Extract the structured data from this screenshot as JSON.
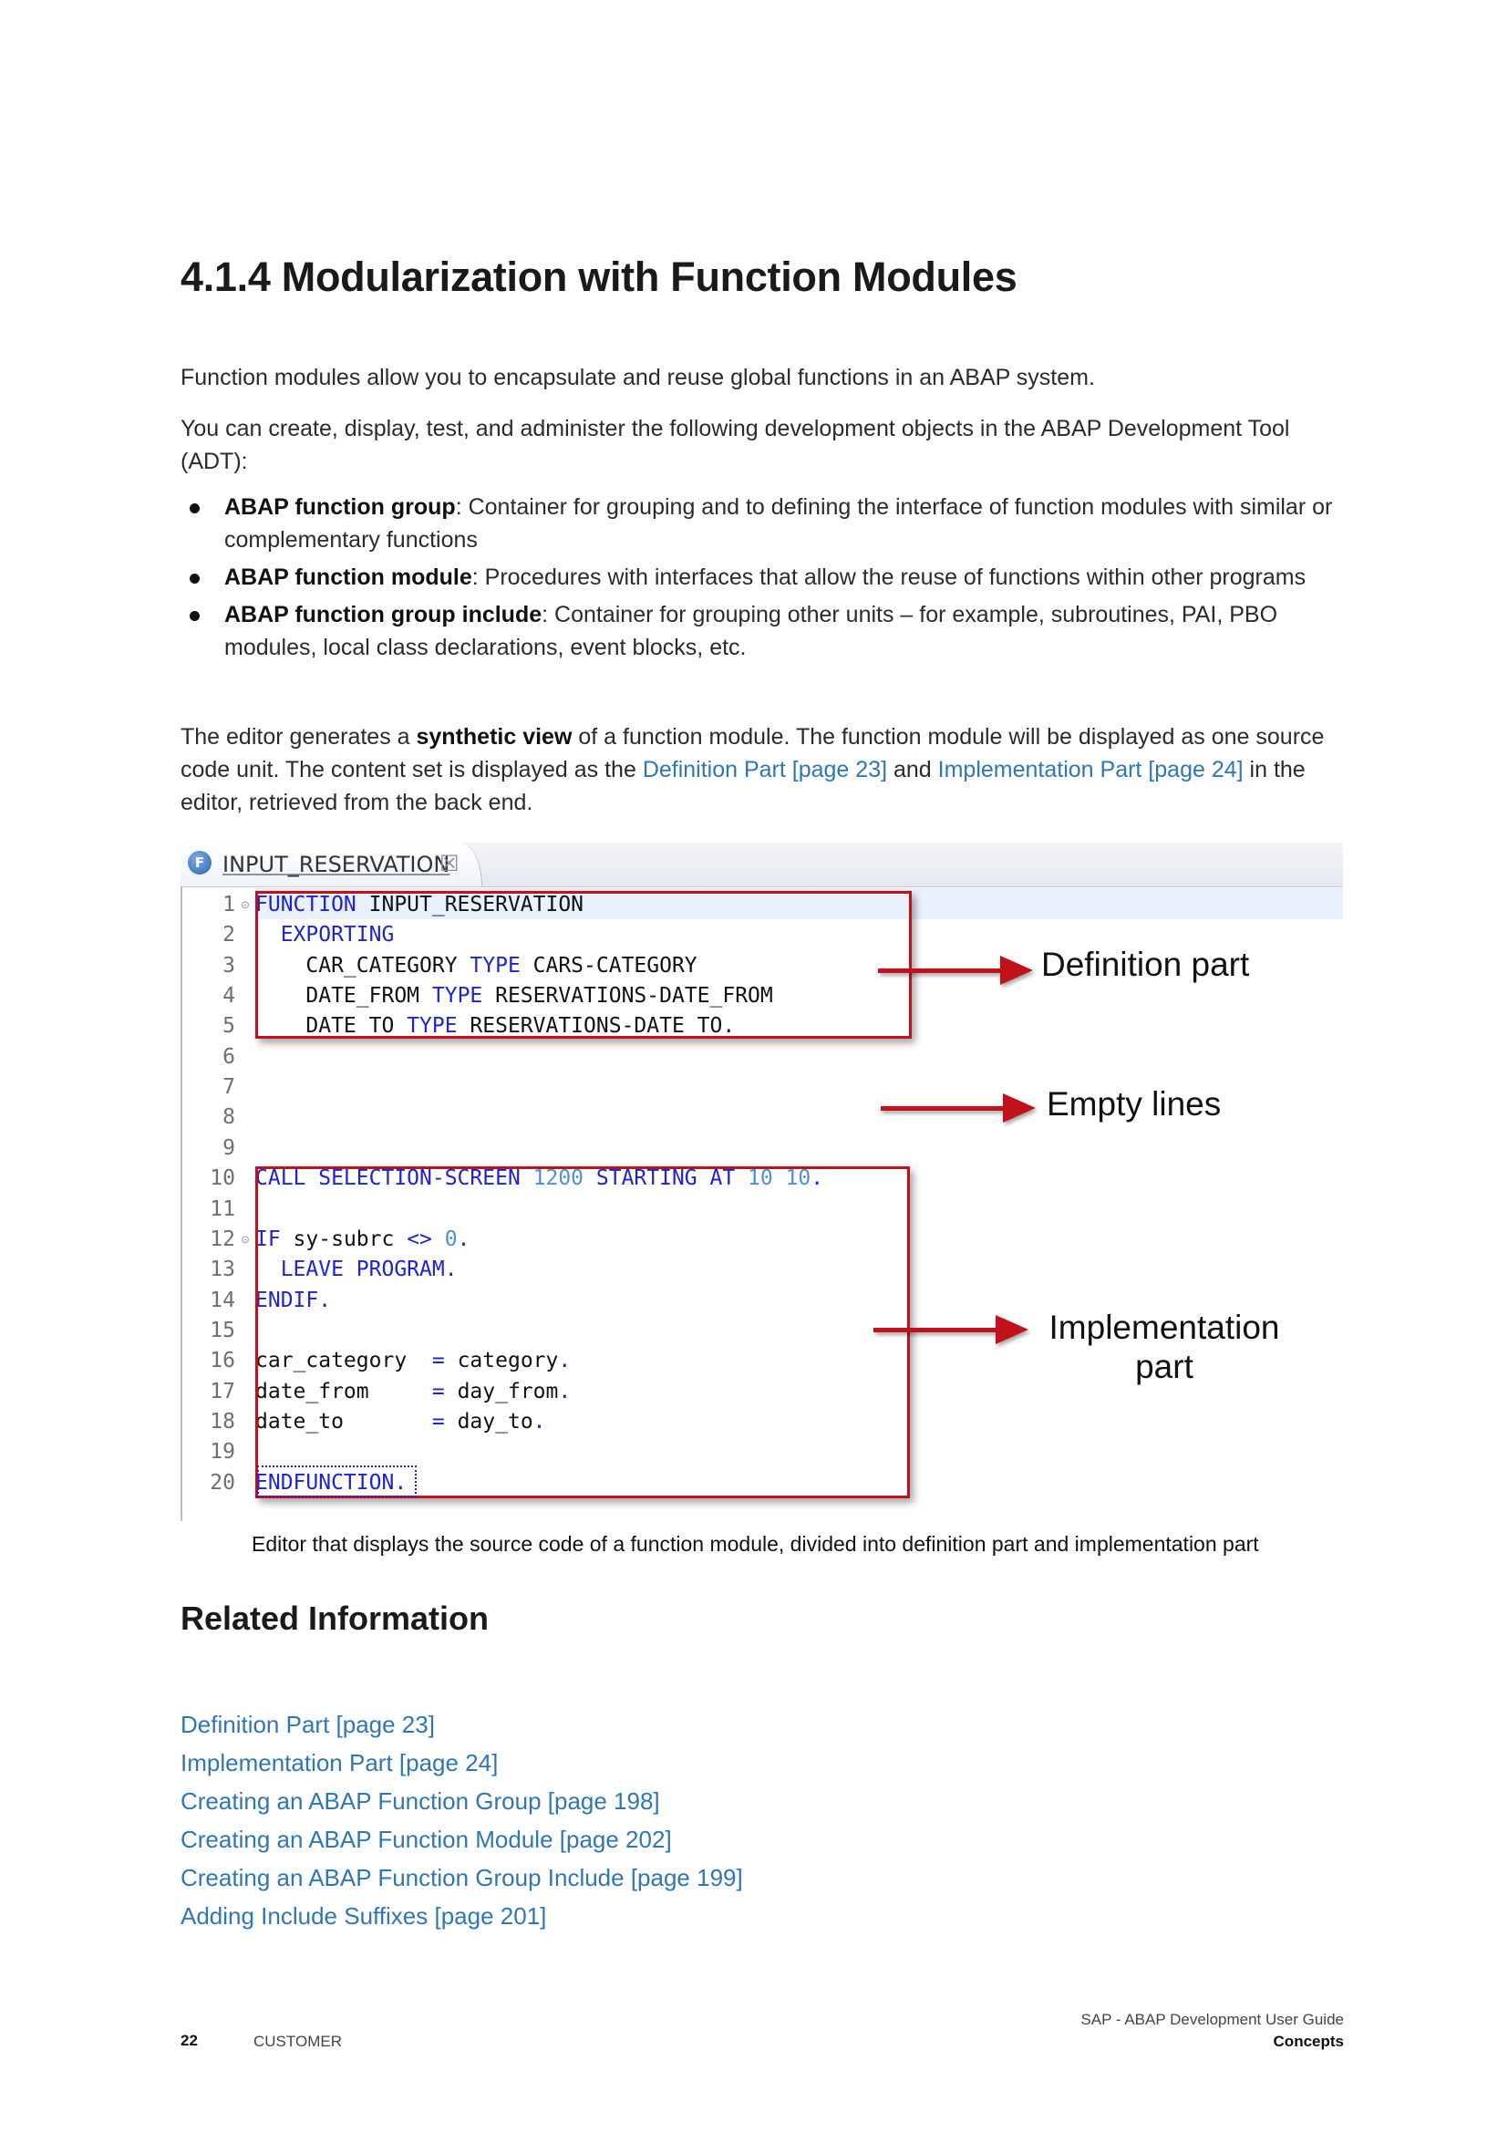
{
  "heading": "4.1.4  Modularization with Function Modules",
  "intro": {
    "p1": "Function modules allow you to encapsulate and reuse global functions in an ABAP system.",
    "p2": "You can create, display, test, and administer the following development objects in the ABAP Development Tool (ADT):"
  },
  "bullets": [
    {
      "term": "ABAP function group",
      "text": ": Container for grouping and to defining the interface of function modules with similar or complementary functions"
    },
    {
      "term": "ABAP function module",
      "text": ": Procedures with interfaces that allow the reuse of functions within other programs"
    },
    {
      "term": "ABAP function group include",
      "text": ": Container for grouping other units – for example, subroutines, PAI, PBO modules, local class declarations, event blocks, etc."
    }
  ],
  "synthetic": {
    "t1": "The editor generates a ",
    "bold": "synthetic view",
    "t2": " of a function module. The function module will be displayed as one source code unit. The content set is displayed as the ",
    "link1": "Definition Part [page 23]",
    "t3": " and ",
    "link2": "Implementation Part [page 24]",
    "t4": " in the editor, retrieved from the back end."
  },
  "editor": {
    "tab_title": "INPUT_RESERVATION",
    "tab_icon_letter": "F",
    "close_glyph": "☒",
    "fold_glyph": "⊝",
    "lines": [
      {
        "num": "1",
        "tokens": [
          {
            "t": "FUNCTION",
            "c": "k"
          },
          {
            "t": " INPUT_RESERVATION",
            "c": ""
          }
        ]
      },
      {
        "num": "2",
        "tokens": [
          {
            "t": "  EXPORTING",
            "c": "k"
          }
        ]
      },
      {
        "num": "3",
        "tokens": [
          {
            "t": "    CAR_CATEGORY ",
            "c": ""
          },
          {
            "t": "TYPE",
            "c": "k"
          },
          {
            "t": " CARS-CATEGORY",
            "c": ""
          }
        ]
      },
      {
        "num": "4",
        "tokens": [
          {
            "t": "    DATE_FROM ",
            "c": ""
          },
          {
            "t": "TYPE",
            "c": "k"
          },
          {
            "t": " RESERVATIONS-DATE_FROM",
            "c": ""
          }
        ]
      },
      {
        "num": "5",
        "tokens": [
          {
            "t": "    DATE_TO ",
            "c": ""
          },
          {
            "t": "TYPE",
            "c": "k"
          },
          {
            "t": " RESERVATIONS-DATE_TO.",
            "c": ""
          }
        ]
      },
      {
        "num": "6",
        "tokens": []
      },
      {
        "num": "7",
        "tokens": []
      },
      {
        "num": "8",
        "tokens": []
      },
      {
        "num": "9",
        "tokens": []
      },
      {
        "num": "10",
        "tokens": [
          {
            "t": "CALL SELECTION-SCREEN ",
            "c": "k"
          },
          {
            "t": "1200",
            "c": "n"
          },
          {
            "t": " STARTING AT ",
            "c": "k"
          },
          {
            "t": "10 10",
            "c": "n"
          },
          {
            "t": ".",
            "c": "k"
          }
        ]
      },
      {
        "num": "11",
        "tokens": []
      },
      {
        "num": "12",
        "tokens": [
          {
            "t": "IF",
            "c": "k"
          },
          {
            "t": " sy-subrc ",
            "c": ""
          },
          {
            "t": "<>",
            "c": "k"
          },
          {
            "t": " ",
            "c": ""
          },
          {
            "t": "0",
            "c": "n"
          },
          {
            "t": ".",
            "c": "k"
          }
        ]
      },
      {
        "num": "13",
        "tokens": [
          {
            "t": "  LEAVE PROGRAM.",
            "c": "k"
          }
        ]
      },
      {
        "num": "14",
        "tokens": [
          {
            "t": "ENDIF.",
            "c": "k"
          }
        ]
      },
      {
        "num": "15",
        "tokens": []
      },
      {
        "num": "16",
        "tokens": [
          {
            "t": "car_category  ",
            "c": ""
          },
          {
            "t": "=",
            "c": "k"
          },
          {
            "t": " category",
            "c": ""
          },
          {
            "t": ".",
            "c": "k"
          }
        ]
      },
      {
        "num": "17",
        "tokens": [
          {
            "t": "date_from     ",
            "c": ""
          },
          {
            "t": "=",
            "c": "k"
          },
          {
            "t": " day_from",
            "c": ""
          },
          {
            "t": ".",
            "c": "k"
          }
        ]
      },
      {
        "num": "18",
        "tokens": [
          {
            "t": "date_to       ",
            "c": ""
          },
          {
            "t": "=",
            "c": "k"
          },
          {
            "t": " day_to",
            "c": ""
          },
          {
            "t": ".",
            "c": "k"
          }
        ]
      },
      {
        "num": "19",
        "tokens": []
      },
      {
        "num": "20",
        "tokens": [
          {
            "t": "ENDFUNCTION.",
            "c": "k"
          }
        ]
      }
    ],
    "folded_lines": [
      "1",
      "12"
    ],
    "annotations": {
      "definition": "Definition part",
      "empty": "Empty lines",
      "implementation": "Implementation part"
    },
    "colors": {
      "keyword": "#1f22d6",
      "number": "#4e8fd6",
      "box": "#c1121c"
    }
  },
  "caption": "Editor that displays the source code of a function module, divided into definition part and implementation part",
  "related_title": "Related Information",
  "related_links": [
    "Definition Part [page 23]",
    "Implementation Part [page 24]",
    "Creating an ABAP Function Group [page 198]",
    "Creating an ABAP Function Module [page 202]",
    "Creating an ABAP Function Group Include [page 199]",
    "Adding Include Suffixes [page 201]"
  ],
  "footer": {
    "page_number": "22",
    "tag": "CUSTOMER",
    "doc_title": "SAP - ABAP Development User Guide",
    "section": "Concepts"
  },
  "colors": {
    "link": "#2f76b5",
    "text": "#2b2b2b"
  }
}
